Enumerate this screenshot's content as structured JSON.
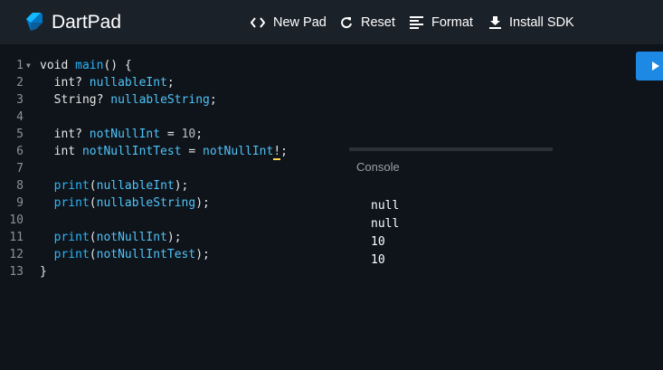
{
  "app": {
    "title": "DartPad",
    "brand_color": "#1e88e5"
  },
  "toolbar": {
    "new_pad": "New Pad",
    "reset": "Reset",
    "format": "Format",
    "install_sdk": "Install SDK"
  },
  "editor": {
    "line_numbers": [
      "1",
      "2",
      "3",
      "4",
      "5",
      "6",
      "7",
      "8",
      "9",
      "10",
      "11",
      "12",
      "13"
    ],
    "lines": [
      [
        {
          "t": "void ",
          "c": ""
        },
        {
          "t": "main",
          "c": "fn"
        },
        {
          "t": "() {",
          "c": ""
        }
      ],
      [
        {
          "t": "  int? ",
          "c": ""
        },
        {
          "t": "nullableInt",
          "c": "id"
        },
        {
          "t": ";",
          "c": ""
        }
      ],
      [
        {
          "t": "  String? ",
          "c": ""
        },
        {
          "t": "nullableString",
          "c": "id"
        },
        {
          "t": ";",
          "c": ""
        }
      ],
      [],
      [
        {
          "t": "  int? ",
          "c": ""
        },
        {
          "t": "notNullInt",
          "c": "id"
        },
        {
          "t": " = ",
          "c": ""
        },
        {
          "t": "10",
          "c": "num"
        },
        {
          "t": ";",
          "c": ""
        }
      ],
      [
        {
          "t": "  int ",
          "c": ""
        },
        {
          "t": "notNullIntTest",
          "c": "id"
        },
        {
          "t": " = ",
          "c": ""
        },
        {
          "t": "notNullInt",
          "c": "id"
        },
        {
          "t": "!",
          "c": "cursor"
        },
        {
          "t": ";",
          "c": ""
        }
      ],
      [],
      [
        {
          "t": "  ",
          "c": ""
        },
        {
          "t": "print",
          "c": "fn"
        },
        {
          "t": "(",
          "c": ""
        },
        {
          "t": "nullableInt",
          "c": "id"
        },
        {
          "t": ");",
          "c": ""
        }
      ],
      [
        {
          "t": "  ",
          "c": ""
        },
        {
          "t": "print",
          "c": "fn"
        },
        {
          "t": "(",
          "c": ""
        },
        {
          "t": "nullableString",
          "c": "id"
        },
        {
          "t": ");",
          "c": ""
        }
      ],
      [],
      [
        {
          "t": "  ",
          "c": ""
        },
        {
          "t": "print",
          "c": "fn"
        },
        {
          "t": "(",
          "c": ""
        },
        {
          "t": "notNullInt",
          "c": "id"
        },
        {
          "t": ");",
          "c": ""
        }
      ],
      [
        {
          "t": "  ",
          "c": ""
        },
        {
          "t": "print",
          "c": "fn"
        },
        {
          "t": "(",
          "c": ""
        },
        {
          "t": "notNullIntTest",
          "c": "id"
        },
        {
          "t": ");",
          "c": ""
        }
      ],
      [
        {
          "t": "}",
          "c": ""
        }
      ]
    ]
  },
  "console": {
    "title": "Console",
    "output": [
      "null",
      "null",
      "10",
      "10"
    ]
  }
}
